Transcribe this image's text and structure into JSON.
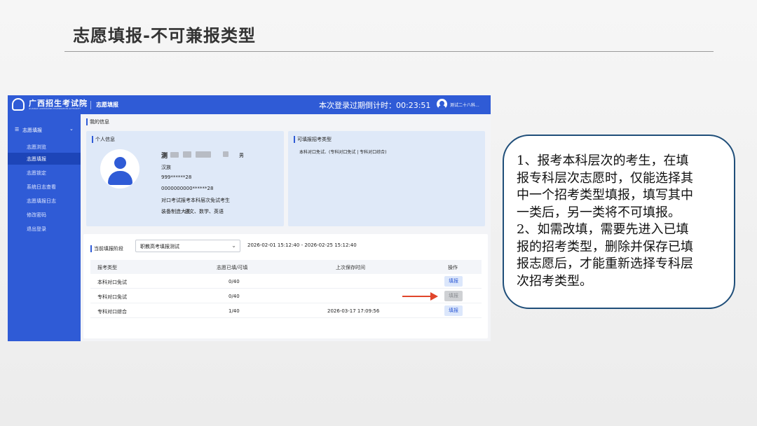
{
  "slide": {
    "title": "志愿填报-不可兼报类型"
  },
  "app": {
    "logo_name": "广西招生考试院",
    "logo_en": "GUANGXI ADMISSIONS EXAMINATION AUTHORITY",
    "section": "志愿填报",
    "countdown_label": "本次登录过期倒计时：",
    "countdown_value": "00:23:51",
    "user": "测试二十八科..."
  },
  "sidebar": {
    "head": {
      "icon": "menu-icon",
      "label": "志愿填报",
      "chevron": "chevron-down-icon"
    },
    "items": [
      {
        "label": "志愿浏览",
        "active": false
      },
      {
        "label": "志愿填报",
        "active": true
      },
      {
        "label": "志愿锁定",
        "active": false
      },
      {
        "label": "系统日志查看",
        "active": false
      },
      {
        "label": "志愿填报日志",
        "active": false
      },
      {
        "label": "修改密码",
        "active": false
      },
      {
        "label": "退出登录",
        "active": false
      }
    ]
  },
  "my_info": {
    "title": "我的信息",
    "personal": {
      "title": "个人信息",
      "name": "测",
      "gender": "男",
      "ethnicity": "汉族",
      "id_masked": "999******28",
      "exam_no": "0000000000******28",
      "category": "对口考试报考本科层次免试考生",
      "major_group": "装备制造大类",
      "subjects": "语文、数学、英语"
    },
    "allowed": {
      "title": "可填报招考类型",
      "text": "本科对口免试、(专科对口免试 | 专科对口综合)"
    }
  },
  "stage": {
    "label": "当前填报阶段",
    "selected": "职教高考填报测试",
    "range": "2026-02-01 15:12:40 - 2026-02-25 15:12:40"
  },
  "table": {
    "headers": [
      "报考类型",
      "志愿已填/可填",
      "上次保存时间",
      "操作"
    ],
    "rows": [
      {
        "type": "本科对口免试",
        "count": "0/40",
        "saved": "",
        "action": "填报",
        "disabled": false
      },
      {
        "type": "专科对口免试",
        "count": "0/40",
        "saved": "",
        "action": "填报",
        "disabled": true
      },
      {
        "type": "专科对口综合",
        "count": "1/40",
        "saved": "2026-03-17 17:09:56",
        "action": "填报",
        "disabled": false
      }
    ]
  },
  "note": {
    "p1_lines": [
      "1、报考本科层次的考生，在填",
      "报专科层次志愿时，仅能选择其",
      "中一个招考类型填报，填写其中",
      "一类后，另一类将不可填报。"
    ],
    "p2_lines": [
      "2、如需改填，需要先进入已填",
      "报的招考类型，删除并保存已填",
      "报志愿后，才能重新选择专科层",
      "次招考类型。"
    ]
  },
  "colors": {
    "brand": "#2f5bd6",
    "arrow": "#e0452b",
    "note_border": "#1f4e79"
  }
}
